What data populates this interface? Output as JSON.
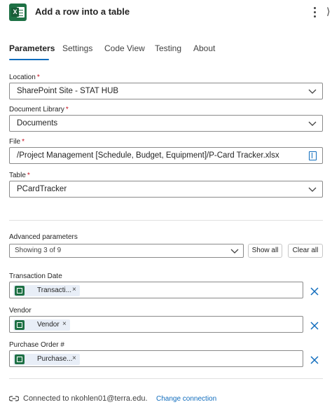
{
  "header": {
    "title": "Add a row into a table",
    "icon": "excel-icon",
    "more_icon": "more-vertical-icon"
  },
  "tabs": [
    {
      "label": "Parameters",
      "active": true
    },
    {
      "label": "Settings",
      "active": false
    },
    {
      "label": "Code View",
      "active": false
    },
    {
      "label": "Testing",
      "active": false
    },
    {
      "label": "About",
      "active": false
    }
  ],
  "form": {
    "location": {
      "label": "Location",
      "required_mark": "*",
      "value": "SharePoint Site - STAT HUB"
    },
    "library": {
      "label": "Document Library",
      "required_mark": "*",
      "value": "Documents"
    },
    "file": {
      "label": "File",
      "required_mark": "*",
      "value": "/Project Management [Schedule, Budget, Equipment]/P-Card Tracker.xlsx"
    },
    "table": {
      "label": "Table",
      "required_mark": "*",
      "value": "PCardTracker"
    }
  },
  "advanced": {
    "label": "Advanced parameters",
    "showing": "Showing 3 of 9",
    "show_all": "Show all",
    "clear_all": "Clear all"
  },
  "params": [
    {
      "label": "Transaction Date",
      "token": "Transacti...",
      "close": "×"
    },
    {
      "label": "Vendor",
      "token": "Vendor",
      "close": "×"
    },
    {
      "label": "Purchase Order #",
      "token": "Purchase...",
      "close": "×"
    }
  ],
  "footer": {
    "connected_text": "Connected to nkohlen01@terra.edu.",
    "change_link": "Change connection"
  },
  "colors": {
    "accent": "#0f6cbd",
    "excel_green": "#1e7145",
    "required": "#c50f1f",
    "token_bg": "#e8eef7"
  }
}
